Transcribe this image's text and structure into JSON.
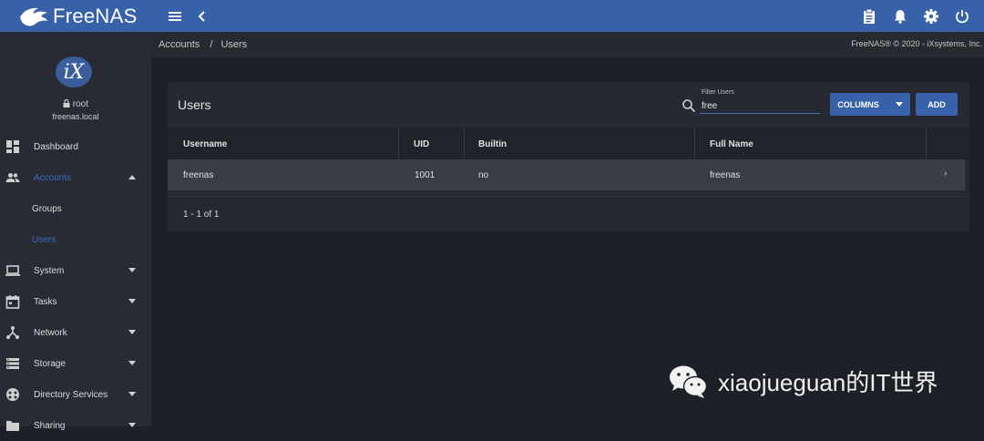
{
  "app": {
    "brand": "FreeNAS"
  },
  "profile": {
    "user": "root",
    "host": "freenas.local",
    "logo_text": "iX"
  },
  "sidebar": {
    "items": [
      {
        "label": "Dashboard"
      },
      {
        "label": "Accounts"
      },
      {
        "label": "Groups"
      },
      {
        "label": "Users"
      },
      {
        "label": "System"
      },
      {
        "label": "Tasks"
      },
      {
        "label": "Network"
      },
      {
        "label": "Storage"
      },
      {
        "label": "Directory Services"
      },
      {
        "label": "Sharing"
      }
    ]
  },
  "breadcrumb": {
    "parent": "Accounts",
    "separator": "/",
    "current": "Users"
  },
  "copyright": "FreeNAS® © 2020 - iXsystems, Inc.",
  "card": {
    "title": "Users",
    "filter_label": "Filter Users",
    "filter_value": "free",
    "columns_label": "COLUMNS",
    "add_label": "ADD"
  },
  "table": {
    "headers": [
      "Username",
      "UID",
      "Builtin",
      "Full Name"
    ],
    "rows": [
      {
        "username": "freenas",
        "uid": "1001",
        "builtin": "no",
        "full_name": "freenas"
      }
    ],
    "pager": "1 - 1 of 1"
  },
  "watermark": "xiaojueguan的IT世界",
  "colors": {
    "topbar": "#3761a8",
    "accent": "#3f6cc2",
    "background": "#1e2027"
  },
  "icons": [
    "freenas-logo-icon",
    "menu-icon",
    "back-icon",
    "clipboard-icon",
    "bell-icon",
    "gear-icon",
    "power-icon",
    "lock-icon",
    "dashboard-icon",
    "accounts-icon",
    "system-icon",
    "tasks-icon",
    "network-icon",
    "storage-icon",
    "directory-services-icon",
    "sharing-icon",
    "search-icon",
    "wechat-icon"
  ]
}
